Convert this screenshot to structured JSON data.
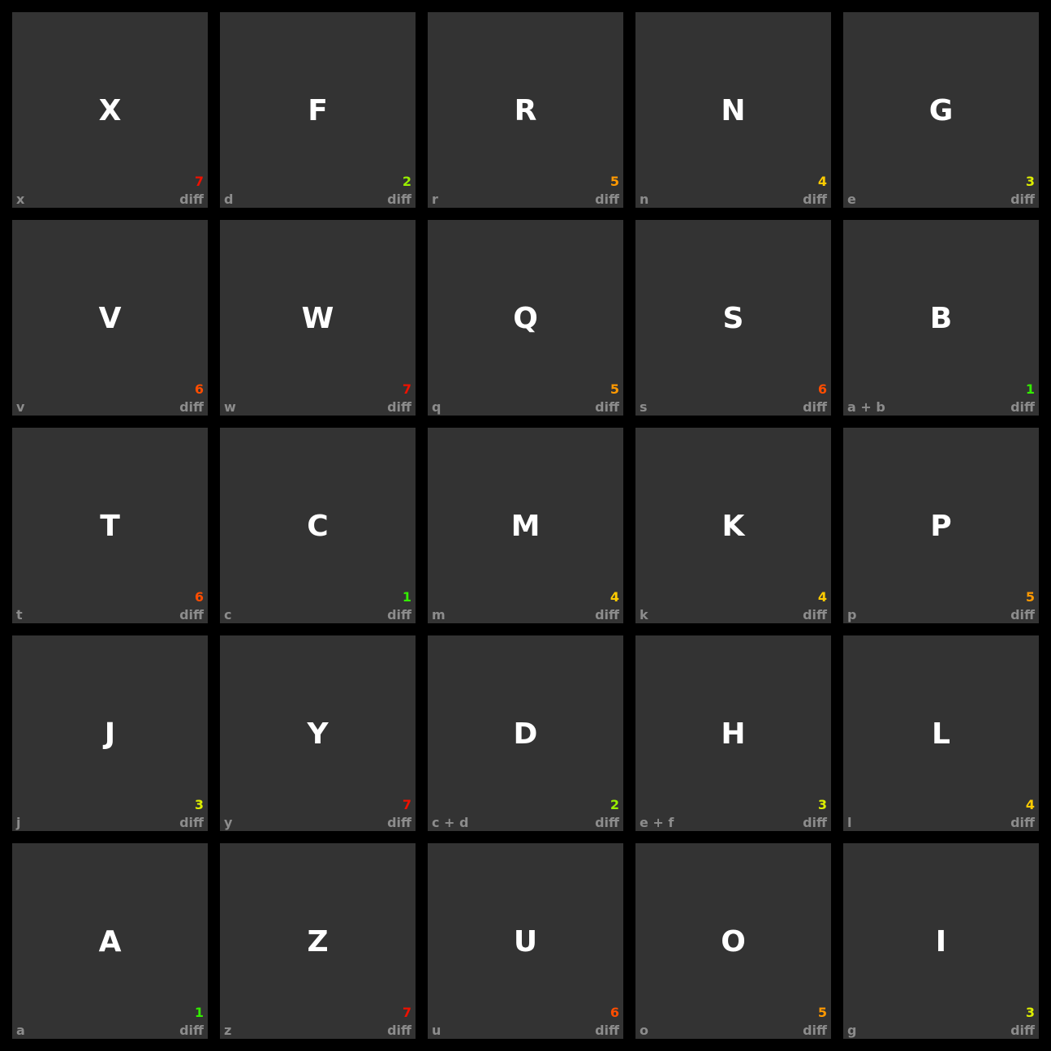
{
  "diff_label": "diff",
  "difficulty_colors": {
    "1": "#33ee00",
    "2": "#99ee00",
    "3": "#ddee00",
    "4": "#ffcc00",
    "5": "#ff9900",
    "6": "#ff4d00",
    "7": "#ee1100"
  },
  "tiles": [
    {
      "letter": "X",
      "hint": "x",
      "difficulty": "7"
    },
    {
      "letter": "F",
      "hint": "d",
      "difficulty": "2"
    },
    {
      "letter": "R",
      "hint": "r",
      "difficulty": "5"
    },
    {
      "letter": "N",
      "hint": "n",
      "difficulty": "4"
    },
    {
      "letter": "G",
      "hint": "e",
      "difficulty": "3"
    },
    {
      "letter": "V",
      "hint": "v",
      "difficulty": "6"
    },
    {
      "letter": "W",
      "hint": "w",
      "difficulty": "7"
    },
    {
      "letter": "Q",
      "hint": "q",
      "difficulty": "5"
    },
    {
      "letter": "S",
      "hint": "s",
      "difficulty": "6"
    },
    {
      "letter": "B",
      "hint": "a + b",
      "difficulty": "1"
    },
    {
      "letter": "T",
      "hint": "t",
      "difficulty": "6"
    },
    {
      "letter": "C",
      "hint": "c",
      "difficulty": "1"
    },
    {
      "letter": "M",
      "hint": "m",
      "difficulty": "4"
    },
    {
      "letter": "K",
      "hint": "k",
      "difficulty": "4"
    },
    {
      "letter": "P",
      "hint": "p",
      "difficulty": "5"
    },
    {
      "letter": "J",
      "hint": "j",
      "difficulty": "3"
    },
    {
      "letter": "Y",
      "hint": "y",
      "difficulty": "7"
    },
    {
      "letter": "D",
      "hint": "c + d",
      "difficulty": "2"
    },
    {
      "letter": "H",
      "hint": "e + f",
      "difficulty": "3"
    },
    {
      "letter": "L",
      "hint": "l",
      "difficulty": "4"
    },
    {
      "letter": "A",
      "hint": "a",
      "difficulty": "1"
    },
    {
      "letter": "Z",
      "hint": "z",
      "difficulty": "7"
    },
    {
      "letter": "U",
      "hint": "u",
      "difficulty": "6"
    },
    {
      "letter": "O",
      "hint": "o",
      "difficulty": "5"
    },
    {
      "letter": "I",
      "hint": "g",
      "difficulty": "3"
    }
  ]
}
